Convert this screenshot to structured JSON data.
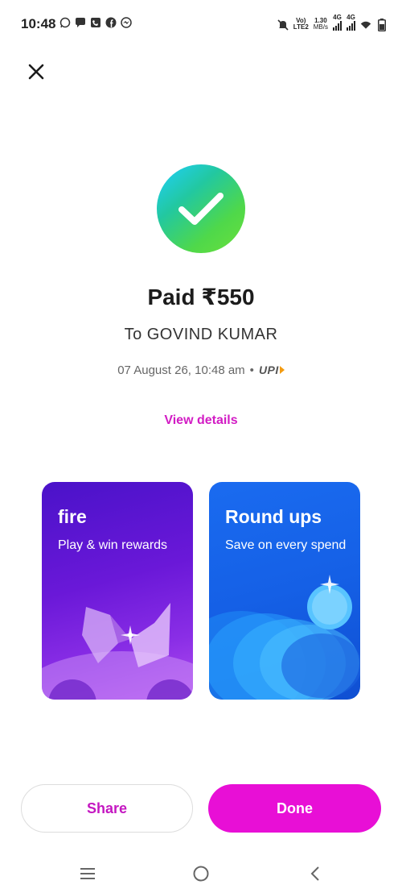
{
  "status_bar": {
    "time": "10:48",
    "left_icons": [
      "whatsapp-icon",
      "chat-bubble-icon",
      "phone-app-icon",
      "facebook-icon",
      "messenger-icon"
    ],
    "volte": "Vo)",
    "lte": "LTE2",
    "speed": "1.30",
    "speed_unit": "MB/s",
    "net1": "4G",
    "net2": "4G"
  },
  "payment": {
    "title": "Paid ₹550",
    "recipient": "To GOVIND  KUMAR",
    "datetime": "07 August 26, 10:48 am",
    "separator": "•",
    "method": "UPI",
    "view_details": "View details"
  },
  "cards": [
    {
      "title": "fire",
      "subtitle": "Play & win rewards"
    },
    {
      "title": "Round ups",
      "subtitle": "Save on every spend"
    }
  ],
  "actions": {
    "share": "Share",
    "done": "Done"
  },
  "colors": {
    "accent": "#e80fd6",
    "accent_text": "#d21cc4"
  }
}
